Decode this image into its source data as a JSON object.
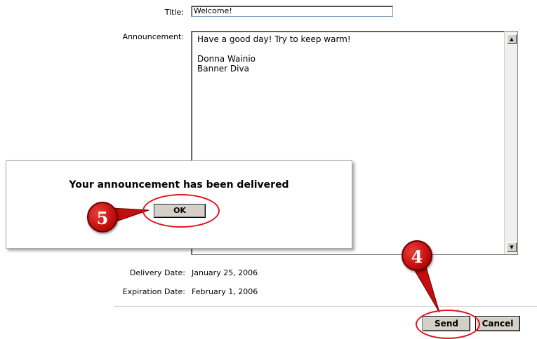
{
  "form": {
    "title_label": "Title:",
    "title_value": "Welcome!",
    "announcement_label": "Announcement:",
    "announcement_text": "Have a good day! Try to keep warm!\n\nDonna Wainio\nBanner Diva",
    "delivery_label": "Delivery Date:",
    "delivery_value": "January 25, 2006",
    "expiration_label": "Expiration Date:",
    "expiration_value": "February 1, 2006"
  },
  "buttons": {
    "send": "Send",
    "cancel": "Cancel"
  },
  "dialog": {
    "message": "Your announcement has been delivered",
    "ok": "OK"
  },
  "callouts": {
    "step_ok": "5",
    "step_send": "4"
  },
  "colors": {
    "callout_red": "#c40d0d",
    "ring_red": "#e0141e"
  }
}
